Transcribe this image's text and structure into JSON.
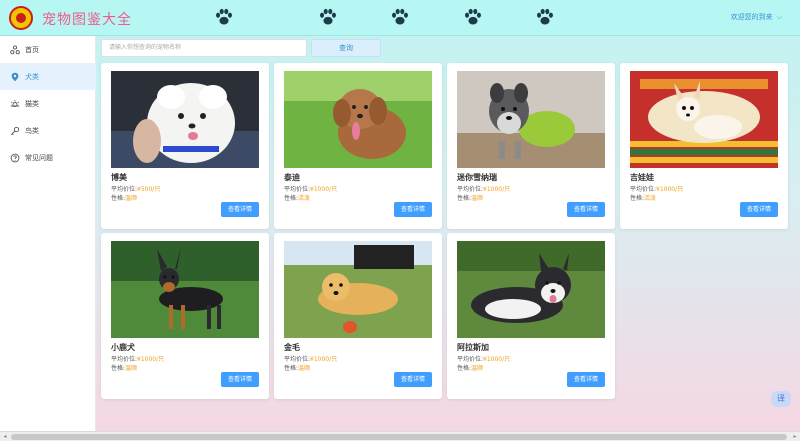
{
  "header": {
    "title": "宠物图鉴大全",
    "welcome": "欢迎您的到来",
    "paw_icons": [
      "paw-icon",
      "paw-icon",
      "paw-icon",
      "paw-icon",
      "paw-icon"
    ],
    "bg_color": "#b6f7f4",
    "title_color": "#ee5b8e"
  },
  "sidebar": {
    "items": [
      {
        "label": "首页",
        "icon": "home-icon",
        "active": false
      },
      {
        "label": "犬类",
        "icon": "location-icon",
        "active": true
      },
      {
        "label": "猫类",
        "icon": "sun-icon",
        "active": false
      },
      {
        "label": "鸟类",
        "icon": "key-icon",
        "active": false
      },
      {
        "label": "常见问题",
        "icon": "help-icon",
        "active": false
      }
    ]
  },
  "search": {
    "placeholder": "请输入你想查询的宠物名称",
    "button_label": "查询"
  },
  "labels": {
    "price_prefix": "平均价位:",
    "temper_prefix": "性格:",
    "detail_button": "查看详情"
  },
  "pets": [
    {
      "name": "博美",
      "price": "¥500/只",
      "temper": "温顺"
    },
    {
      "name": "泰迪",
      "price": "¥1000/只",
      "temper": "活泼"
    },
    {
      "name": "迷你雪纳瑞",
      "price": "¥1000/只",
      "temper": "温顺"
    },
    {
      "name": "吉娃娃",
      "price": "¥1000/只",
      "temper": "活泼"
    },
    {
      "name": "小鹿犬",
      "price": "¥1000/只",
      "temper": "温顺"
    },
    {
      "name": "金毛",
      "price": "¥1000/只",
      "temper": "温顺"
    },
    {
      "name": "阿拉斯加",
      "price": "¥1000/只",
      "temper": "温顺"
    }
  ],
  "translate_button": "译",
  "colors": {
    "accent": "#409eff",
    "highlight": "#f0a020"
  }
}
